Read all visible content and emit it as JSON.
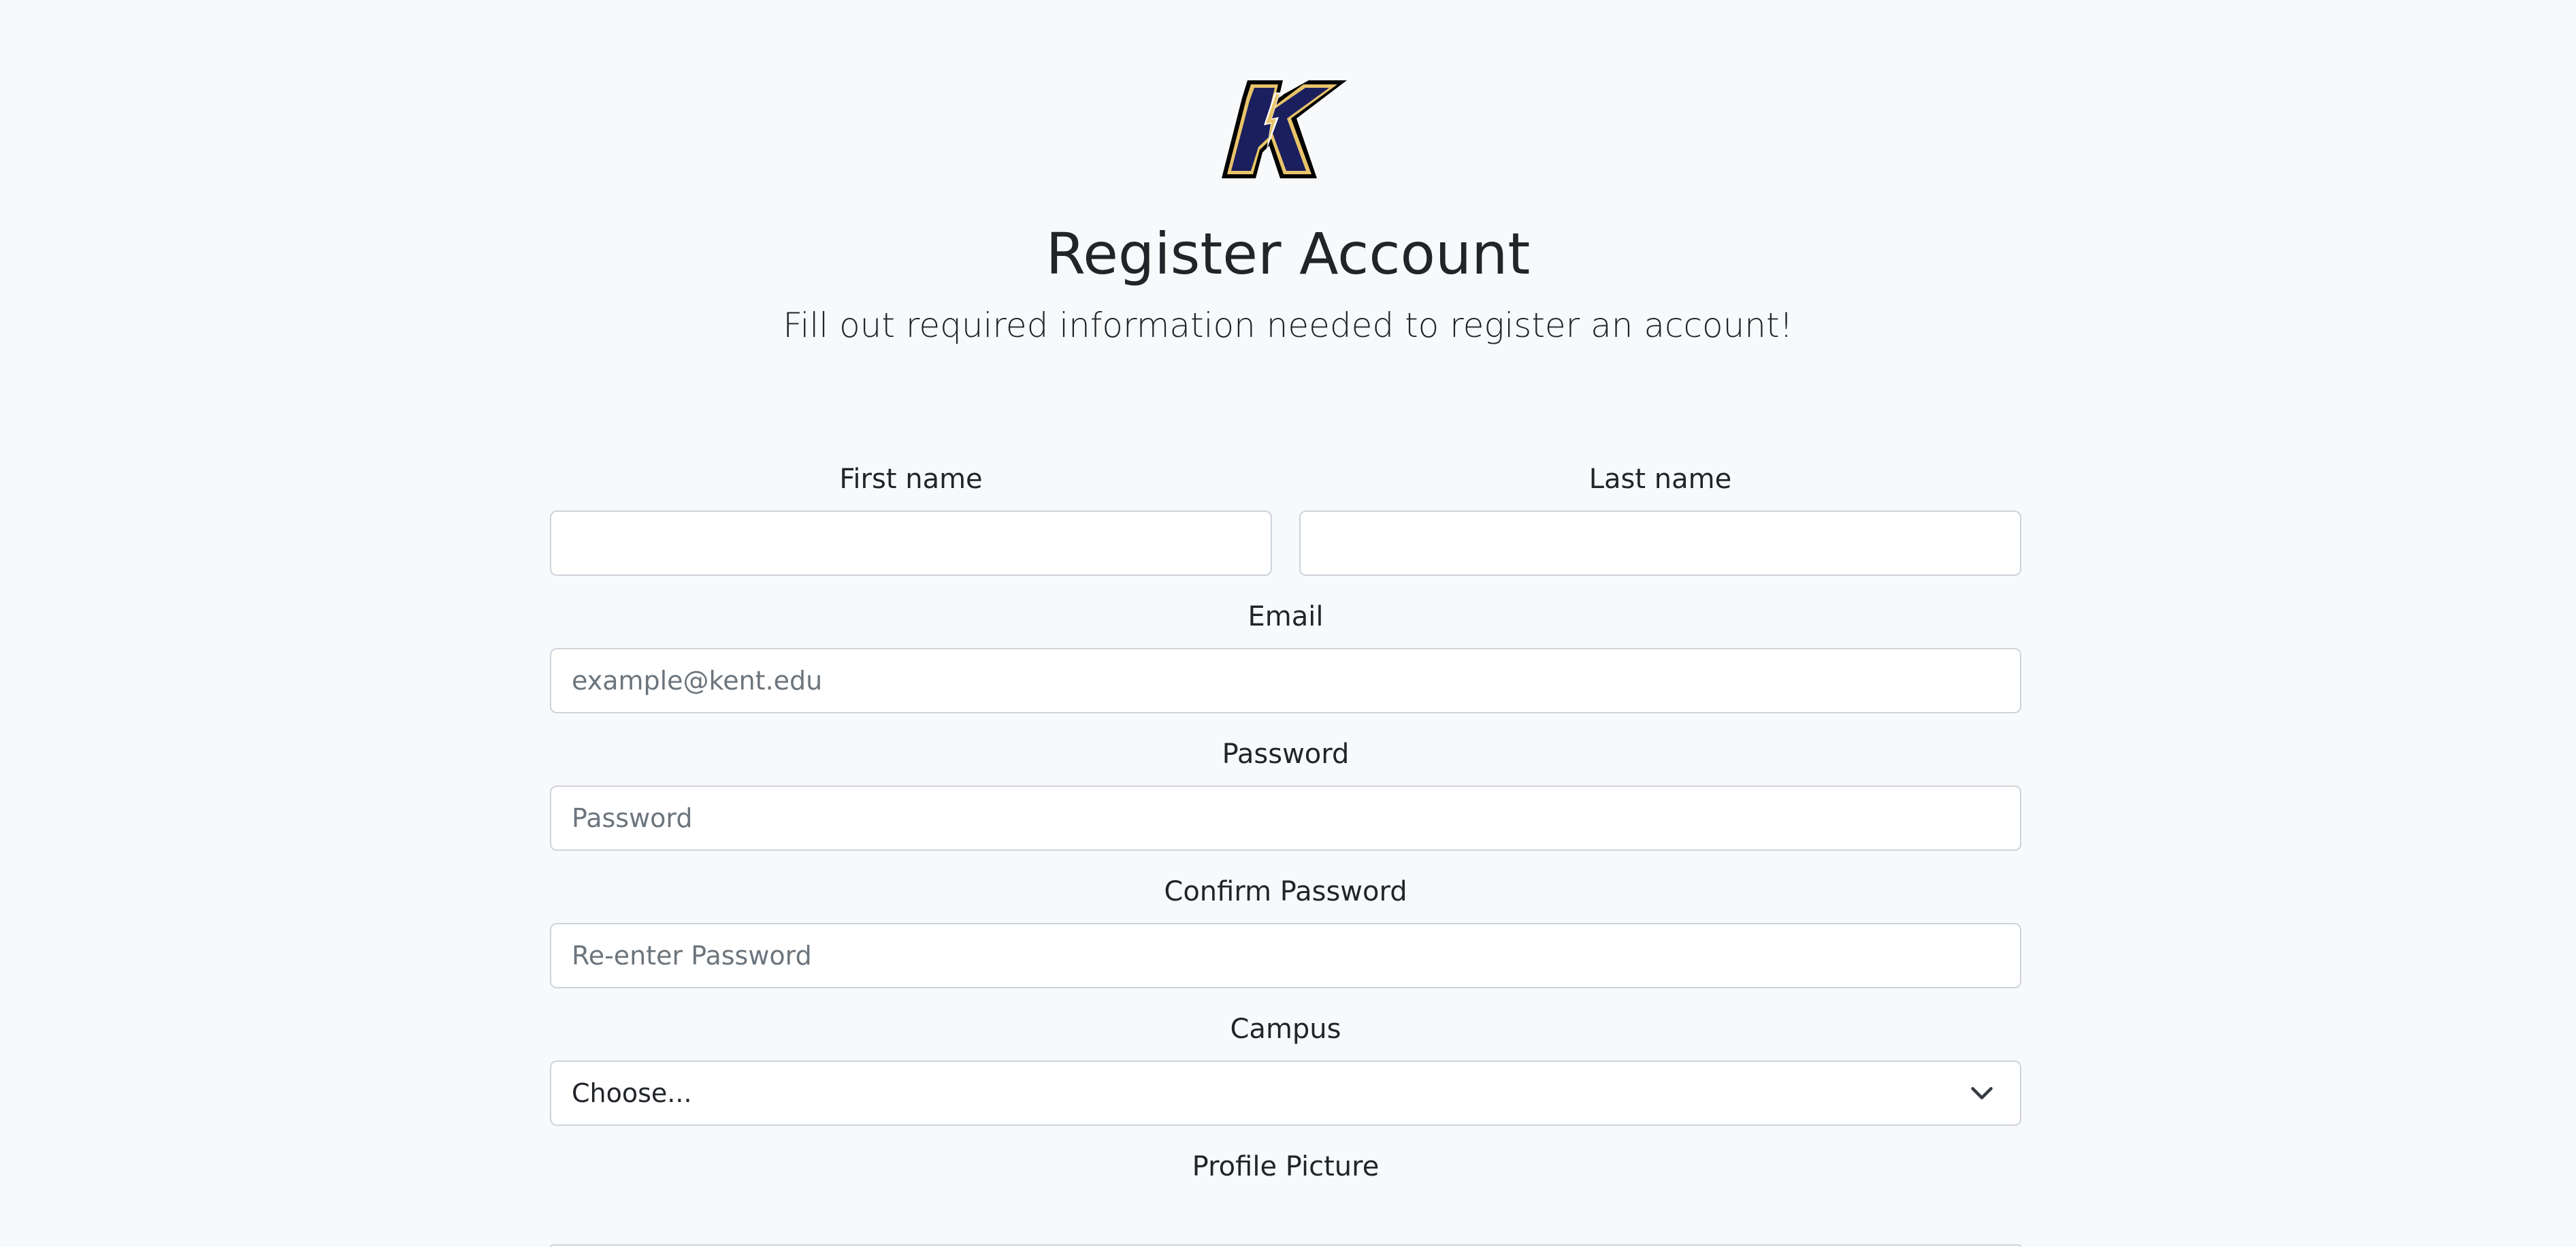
{
  "header": {
    "logo_icon": "kent-state-k-logo",
    "title": "Register Account",
    "subtitle": "Fill out required information needed to register an account!"
  },
  "form": {
    "first_name": {
      "label": "First name",
      "value": "",
      "placeholder": ""
    },
    "last_name": {
      "label": "Last name",
      "value": "",
      "placeholder": ""
    },
    "email": {
      "label": "Email",
      "value": "",
      "placeholder": "example@kent.edu"
    },
    "password": {
      "label": "Password",
      "value": "",
      "placeholder": "Password"
    },
    "confirm_password": {
      "label": "Confirm Password",
      "value": "",
      "placeholder": "Re-enter Password"
    },
    "campus": {
      "label": "Campus",
      "selected": "Choose...",
      "icon": "chevron-down-icon"
    },
    "profile_picture": {
      "label": "Profile Picture"
    }
  },
  "colors": {
    "background": "#f8f9fa",
    "logo_navy": "#1b1f5e",
    "logo_gold": "#e8c46a",
    "border": "#ced4da",
    "placeholder": "#6c757d"
  }
}
